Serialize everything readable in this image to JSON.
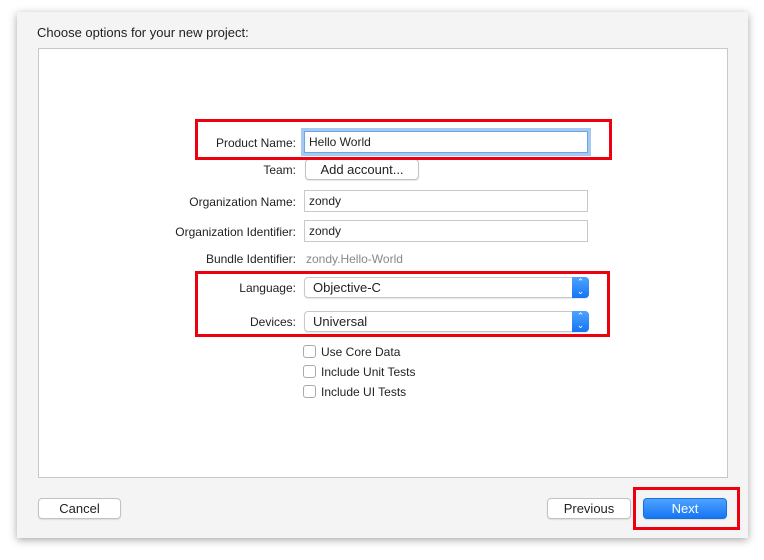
{
  "dialog": {
    "title": "Choose options for your new project:"
  },
  "form": {
    "product_name": {
      "label": "Product Name:",
      "value": "Hello World"
    },
    "team": {
      "label": "Team:",
      "button": "Add account..."
    },
    "organization_name": {
      "label": "Organization Name:",
      "value": "zondy"
    },
    "organization_identifier": {
      "label": "Organization Identifier:",
      "value": "zondy"
    },
    "bundle_identifier": {
      "label": "Bundle Identifier:",
      "value": "zondy.Hello-World"
    },
    "language": {
      "label": "Language:",
      "value": "Objective-C"
    },
    "devices": {
      "label": "Devices:",
      "value": "Universal"
    },
    "checkboxes": [
      {
        "label": "Use Core Data",
        "checked": false
      },
      {
        "label": "Include Unit Tests",
        "checked": false
      },
      {
        "label": "Include UI Tests",
        "checked": false
      }
    ]
  },
  "footer": {
    "cancel": "Cancel",
    "previous": "Previous",
    "next": "Next"
  },
  "colors": {
    "accent": "#1a7cf5",
    "highlight": "#ee0010"
  }
}
